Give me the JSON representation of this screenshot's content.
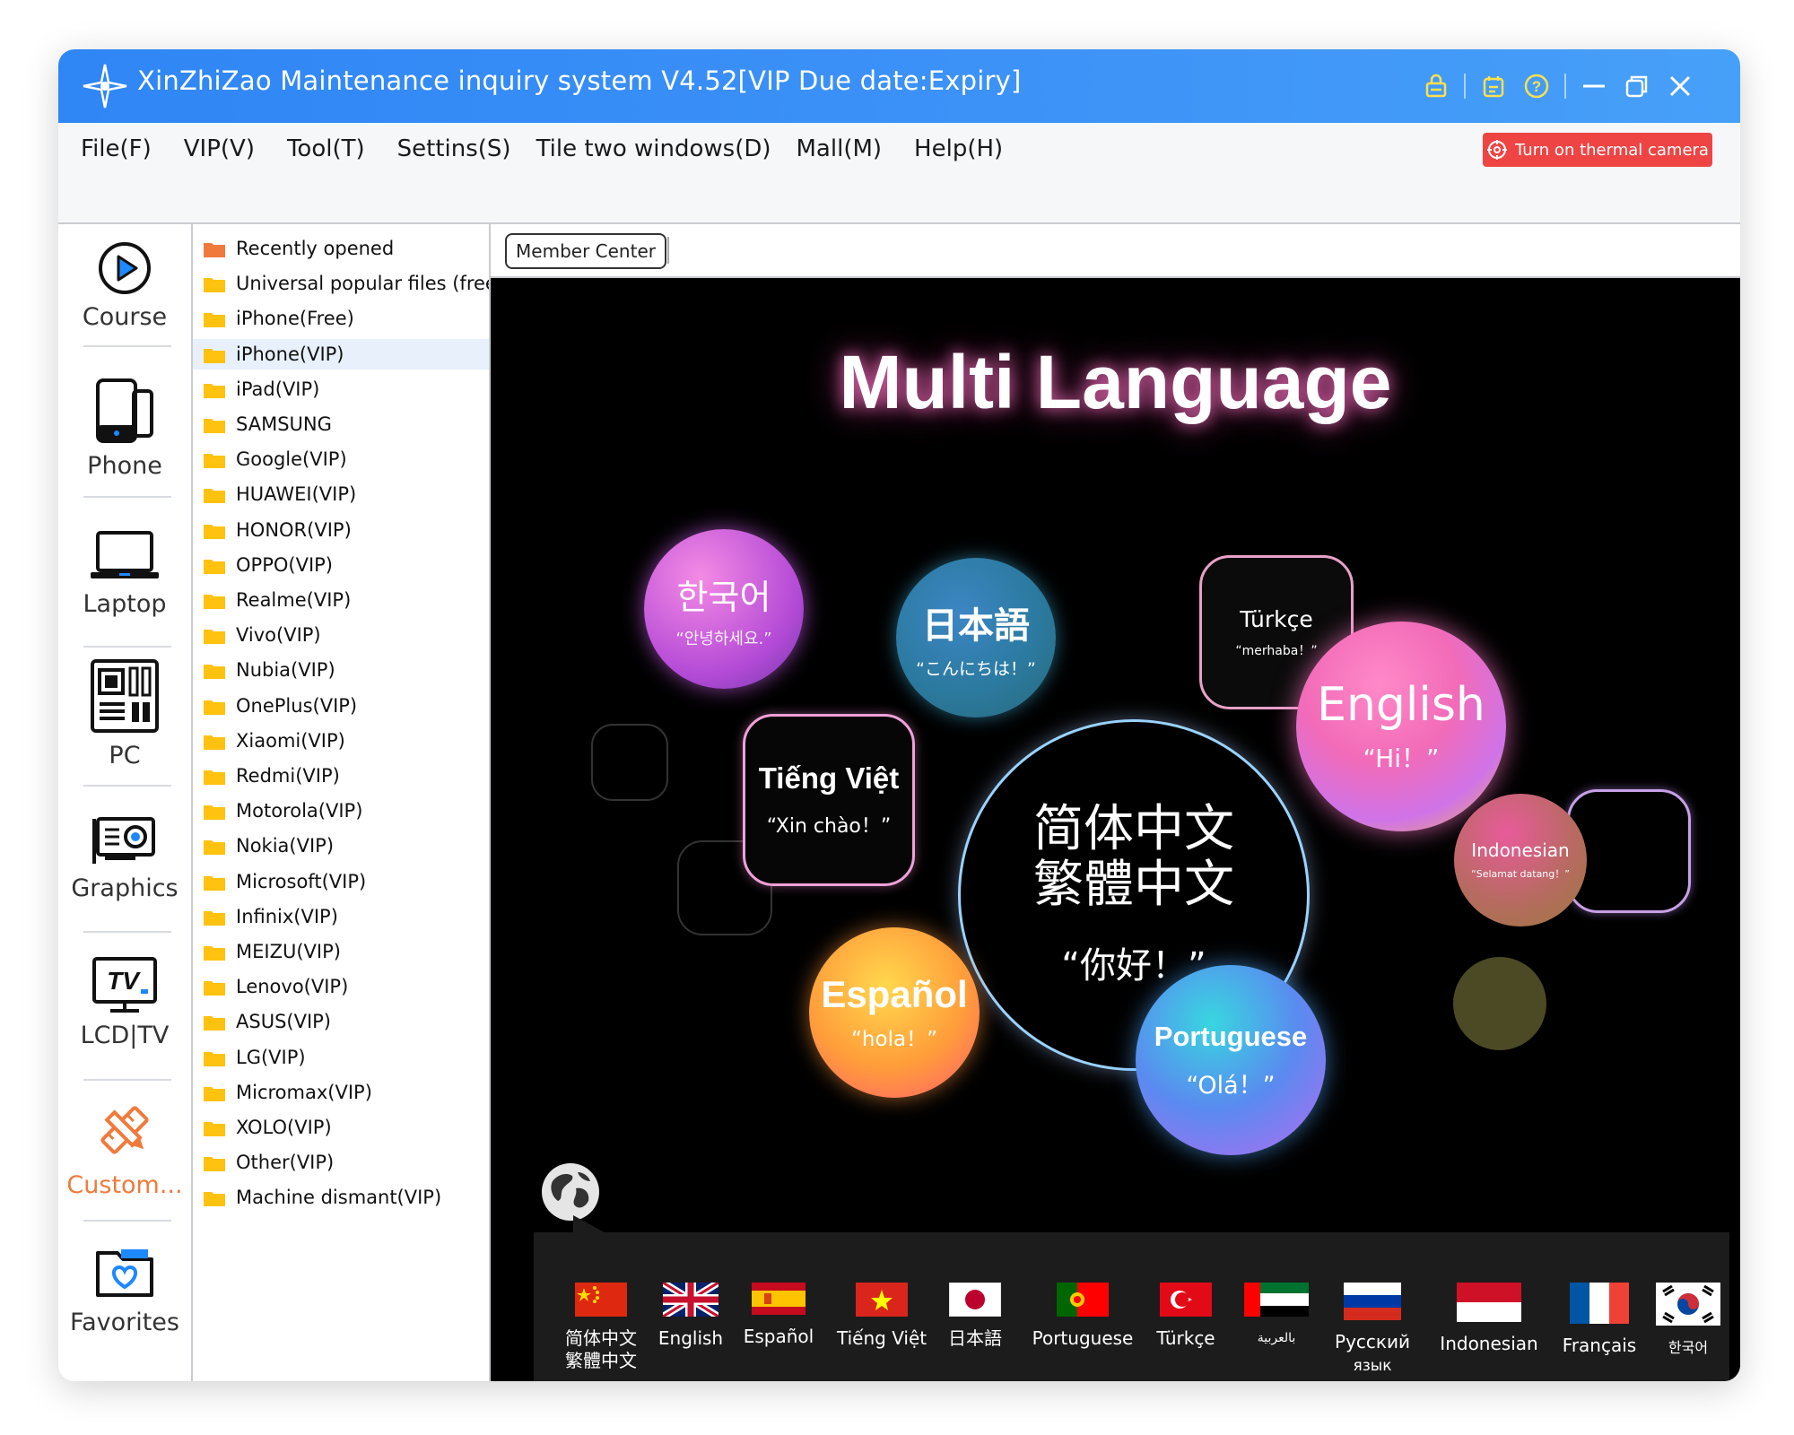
{
  "window": {
    "title": "XinZhiZao Maintenance inquiry system V4.52[VIP Due date:Expiry]"
  },
  "titlebar_icons": [
    "lock-icon",
    "calendar-icon",
    "help-icon",
    "minimize-icon",
    "restore-icon",
    "close-icon"
  ],
  "menu": {
    "items": [
      "File(F)",
      "VIP(V)",
      "Tool(T)",
      "Settins(S)",
      "Tile two windows(D)",
      "Mall(M)",
      "Help(H)"
    ],
    "thermal_button": "Turn on thermal camera"
  },
  "nav": [
    {
      "label": "Course",
      "icon": "play-icon"
    },
    {
      "label": "Phone",
      "icon": "phone-icon"
    },
    {
      "label": "Laptop",
      "icon": "laptop-icon"
    },
    {
      "label": "PC",
      "icon": "motherboard-icon"
    },
    {
      "label": "Graphics",
      "icon": "graphics-card-icon"
    },
    {
      "label": "LCD|TV",
      "icon": "tv-icon"
    },
    {
      "label": "Custom...",
      "icon": "pencil-ruler-icon",
      "active": true
    },
    {
      "label": "Favorites",
      "icon": "heart-folder-icon"
    }
  ],
  "tree": {
    "items": [
      "Recently opened",
      "Universal popular files (free)",
      "iPhone(Free)",
      "iPhone(VIP)",
      "iPad(VIP)",
      "SAMSUNG",
      "Google(VIP)",
      "HUAWEI(VIP)",
      "HONOR(VIP)",
      "OPPO(VIP)",
      "Realme(VIP)",
      "Vivo(VIP)",
      "Nubia(VIP)",
      "OnePlus(VIP)",
      "Xiaomi(VIP)",
      "Redmi(VIP)",
      "Motorola(VIP)",
      "Nokia(VIP)",
      "Microsoft(VIP)",
      "Infinix(VIP)",
      "MEIZU(VIP)",
      "Lenovo(VIP)",
      "ASUS(VIP)",
      "LG(VIP)",
      "Micromax(VIP)",
      "XOLO(VIP)",
      "Other(VIP)",
      "Machine dismant(VIP)"
    ],
    "selected": "iPhone(VIP)"
  },
  "tabs": {
    "member_center": "Member Center"
  },
  "banner": {
    "title": "Multi Language",
    "korean": {
      "name": "한국어",
      "greet": "“안녕하세요.”"
    },
    "japanese": {
      "name": "日本語",
      "greet": "“こんにちは！”"
    },
    "turkish": {
      "name": "Türkçe",
      "greet": "“merhaba！”"
    },
    "english": {
      "name": "English",
      "greet": "“Hi！”"
    },
    "vietnamese": {
      "name": "Tiếng Việt",
      "greet": "“Xin chào！”"
    },
    "chinese": {
      "line1": "简体中文",
      "line2": "繁體中文",
      "greet": "“你好！”"
    },
    "indonesian": {
      "name": "Indonesian",
      "greet": "“Selamat datang！”"
    },
    "spanish": {
      "name": "Español",
      "greet": "“hola！”"
    },
    "portuguese": {
      "name": "Portuguese",
      "greet": "“Olá！”"
    }
  },
  "flags": [
    {
      "label": "简体中文\n繁體中文",
      "flag": "china-flag"
    },
    {
      "label": "English",
      "flag": "uk-flag"
    },
    {
      "label": "Español",
      "flag": "spain-flag"
    },
    {
      "label": "Tiếng Việt",
      "flag": "vietnam-flag"
    },
    {
      "label": "日本語",
      "flag": "japan-flag"
    },
    {
      "label": "Portuguese",
      "flag": "portugal-flag"
    },
    {
      "label": "Türkçe",
      "flag": "turkey-flag"
    },
    {
      "label": "بالعربية",
      "flag": "uae-flag"
    },
    {
      "label": "Русский\nязык",
      "flag": "russia-flag"
    },
    {
      "label": "Indonesian",
      "flag": "indonesia-flag"
    },
    {
      "label": "Français",
      "flag": "france-flag"
    },
    {
      "label": "한국어",
      "flag": "korea-flag"
    }
  ]
}
